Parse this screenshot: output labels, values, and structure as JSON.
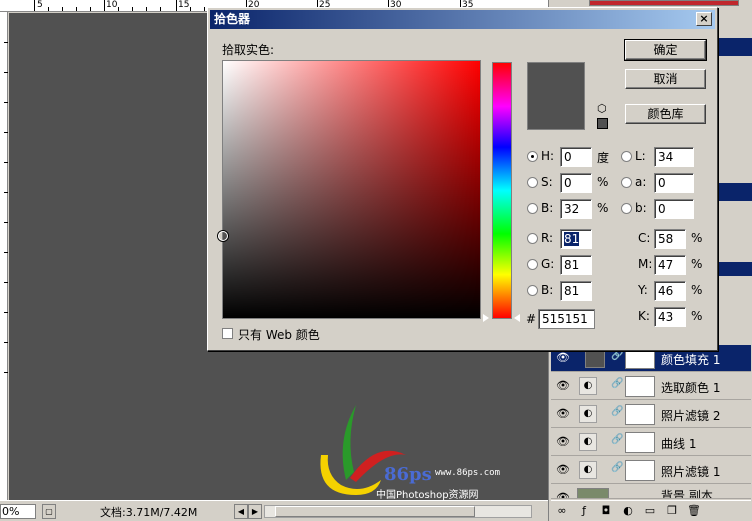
{
  "ruler": {
    "top_numbers": [
      "5",
      "10",
      "15",
      "20",
      "25",
      "30",
      "35"
    ]
  },
  "canvas_color": "#515151",
  "status": {
    "zoom": "0%",
    "doc_info": "文档:3.71M/7.42M"
  },
  "dialog": {
    "title": "拾色器",
    "close": "×",
    "pick_label": "拾取实色:",
    "buttons": {
      "ok": "确定",
      "cancel": "取消",
      "library": "颜色库"
    },
    "hsb": [
      {
        "label": "H:",
        "value": "0",
        "unit": "度"
      },
      {
        "label": "S:",
        "value": "0",
        "unit": "%"
      },
      {
        "label": "B:",
        "value": "32",
        "unit": "%"
      }
    ],
    "lab": [
      {
        "label": "L:",
        "value": "34"
      },
      {
        "label": "a:",
        "value": "0"
      },
      {
        "label": "b:",
        "value": "0"
      }
    ],
    "rgb": [
      {
        "label": "R:",
        "value": "81"
      },
      {
        "label": "G:",
        "value": "81"
      },
      {
        "label": "B:",
        "value": "81"
      }
    ],
    "cmyk": [
      {
        "label": "C:",
        "value": "58",
        "unit": "%"
      },
      {
        "label": "M:",
        "value": "47",
        "unit": "%"
      },
      {
        "label": "Y:",
        "value": "46",
        "unit": "%"
      },
      {
        "label": "K:",
        "value": "43",
        "unit": "%"
      }
    ],
    "hex_label": "#",
    "hex_value": "515151",
    "web_only": "只有 Web 颜色",
    "selected_color": "#515151",
    "field_hue_color": "#ff0000"
  },
  "layers": [
    {
      "name": "颜色填充 1",
      "selected": true
    },
    {
      "name": "选取颜色 1",
      "selected": false
    },
    {
      "name": "照片滤镜 2",
      "selected": false
    },
    {
      "name": "曲线 1",
      "selected": false
    },
    {
      "name": "照片滤镜 1",
      "selected": false
    },
    {
      "name": "背景 副本",
      "selected": false
    }
  ],
  "watermark": {
    "brand": "86ps",
    "url": "www.86ps.com",
    "cn": "中国Photoshop资源网"
  }
}
